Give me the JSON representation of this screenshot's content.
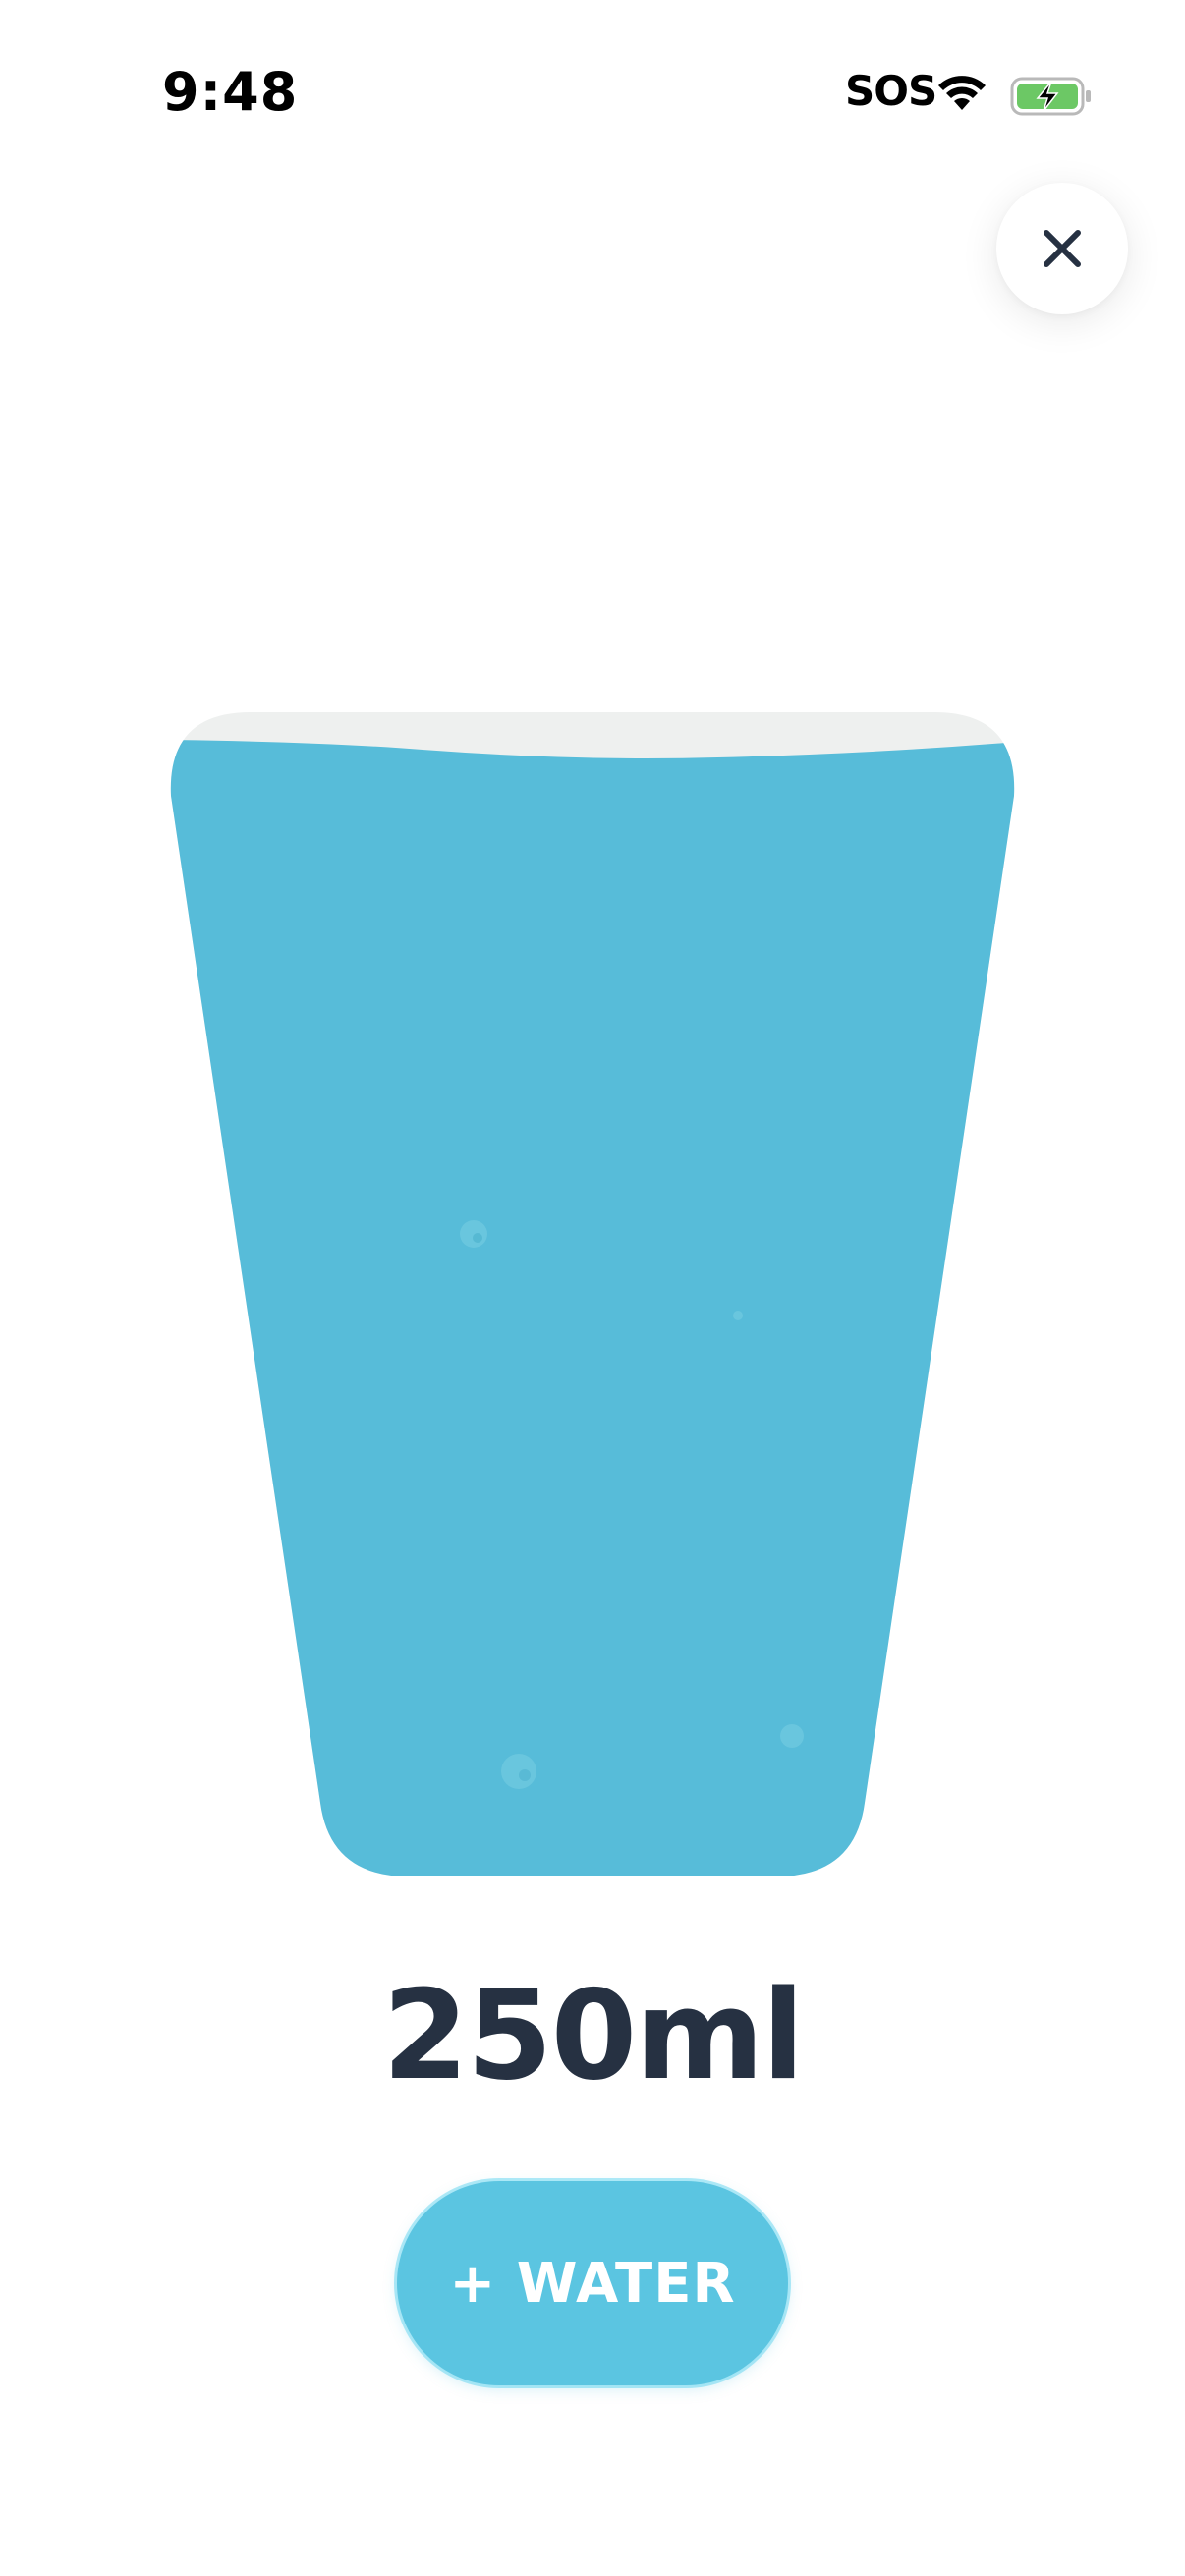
{
  "status_bar": {
    "time": "9:48",
    "network": "SOS",
    "wifi_icon": "wifi-icon",
    "battery_icon": "battery-charging-icon",
    "battery_color": "#6cc865"
  },
  "close": {
    "icon": "close-icon",
    "color": "#263142"
  },
  "glass": {
    "icon": "water-glass-icon",
    "fill_fraction": 0.97,
    "water_color": "#57bcd9",
    "rim_color": "#eef0ef"
  },
  "amount": {
    "text": "250ml"
  },
  "add_button": {
    "label": "+ WATER",
    "color": "#5bc5e1"
  }
}
